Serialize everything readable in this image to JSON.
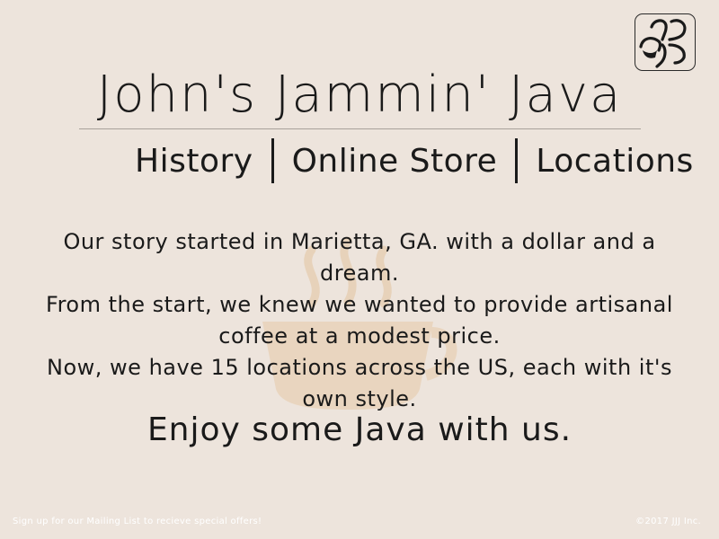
{
  "brand": {
    "title": "John's Jammin' Java"
  },
  "nav": {
    "items": [
      {
        "label": "History"
      },
      {
        "label": "Online Store"
      },
      {
        "label": "Locations"
      }
    ]
  },
  "story": {
    "line1": "Our story started in Marietta, GA. with a dollar and a dream.",
    "line2": "From the start, we knew we wanted to provide artisanal coffee at a modest price.",
    "line3": "Now, we have 15 locations across the US, each with it's own style.",
    "tagline": "Enjoy some Java with us."
  },
  "footer": {
    "mailing_list": "Sign up for our Mailing List to recieve special offers!",
    "copyright": "©2017 JJJ Inc."
  },
  "colors": {
    "background": "#ede4dc",
    "text": "#1a1a1a",
    "cup_watermark": "#e6c9a8",
    "footer_text": "#ffffff"
  },
  "icons": {
    "logo": "jjj-logo-icon",
    "watermark": "coffee-cup-icon"
  }
}
